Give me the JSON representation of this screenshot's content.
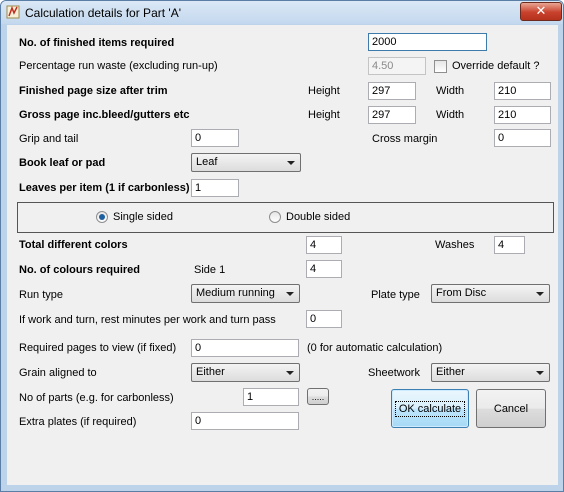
{
  "window": {
    "title": "Calculation details for Part 'A'",
    "close_glyph": "✕"
  },
  "rows": {
    "finished_items": {
      "label": "No. of finished items required",
      "value": "2000"
    },
    "run_waste": {
      "label": "Percentage run waste (excluding run-up)",
      "value": "4.50",
      "override_label": "Override default ?"
    },
    "finished_size": {
      "label": "Finished page size after trim",
      "height_label": "Height",
      "height": "297",
      "width_label": "Width",
      "width": "210"
    },
    "gross_size": {
      "label": "Gross page inc.bleed/gutters etc",
      "height_label": "Height",
      "height": "297",
      "width_label": "Width",
      "width": "210"
    },
    "grip_tail": {
      "label": "Grip and tail",
      "value": "0",
      "cross_label": "Cross margin",
      "cross_value": "0"
    },
    "book_leaf": {
      "label": "Book leaf or pad",
      "selected": "Leaf"
    },
    "leaves_per_item": {
      "label": "Leaves per item (1 if carbonless)",
      "value": "1"
    },
    "sides": {
      "single": "Single sided",
      "double": "Double sided",
      "selected": "single"
    },
    "total_colors": {
      "label": "Total different colors",
      "value": "4",
      "washes_label": "Washes",
      "washes": "4"
    },
    "colours_required": {
      "label": "No. of colours required",
      "side_label": "Side 1",
      "value": "4"
    },
    "run_type": {
      "label": "Run type",
      "selected": "Medium running",
      "plate_label": "Plate type",
      "plate_selected": "From Disc"
    },
    "work_turn": {
      "label": "If work and turn, rest minutes per work and turn pass",
      "value": "0"
    },
    "pages_to_view": {
      "label": "Required pages to view (if fixed)",
      "value": "0",
      "note": "(0 for automatic calculation)"
    },
    "grain": {
      "label": "Grain aligned to",
      "selected": "Either",
      "sheetwork_label": "Sheetwork",
      "sheetwork_selected": "Either"
    },
    "parts": {
      "label": "No of parts (e.g. for carbonless)",
      "value": "1",
      "browse_label": "....."
    },
    "extra_plates": {
      "label": "Extra plates (if required)",
      "value": "0"
    }
  },
  "buttons": {
    "ok": "OK calculate",
    "cancel": "Cancel"
  }
}
